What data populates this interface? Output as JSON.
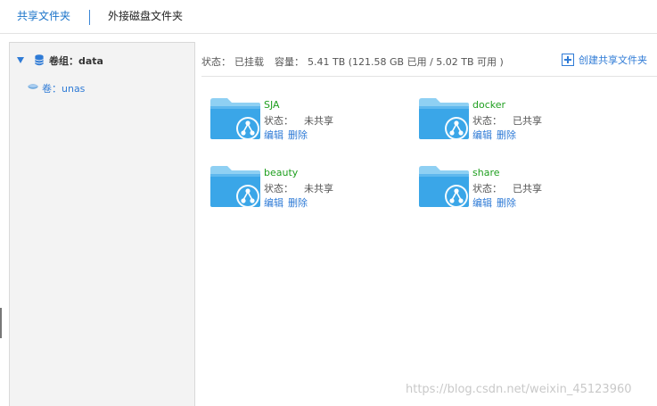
{
  "tabs": [
    {
      "label": "共享文件夹",
      "active": true
    },
    {
      "label": "外接磁盘文件夹",
      "active": false
    }
  ],
  "sidebar": {
    "group_label": "卷组：data",
    "volume_label": "卷：unas"
  },
  "status_bar": {
    "status_key": "状态：",
    "status_value": "已挂载",
    "capacity_key": "容量：",
    "capacity_value": "5.41 TB (121.58 GB 已用 / 5.02 TB 可用 )",
    "create_label": "创建共享文件夹"
  },
  "folders": [
    {
      "name": "SJA",
      "status_key": "状态：",
      "status_value": "未共享",
      "edit": "编辑",
      "delete": "删除"
    },
    {
      "name": "docker",
      "status_key": "状态：",
      "status_value": "已共享",
      "edit": "编辑",
      "delete": "删除"
    },
    {
      "name": "beauty",
      "status_key": "状态：",
      "status_value": "未共享",
      "edit": "编辑",
      "delete": "删除"
    },
    {
      "name": "share",
      "status_key": "状态：",
      "status_value": "已共享",
      "edit": "编辑",
      "delete": "删除"
    }
  ],
  "watermark": "https://blog.csdn.net/weixin_45123960",
  "colors": {
    "accent": "#2f7bd6",
    "folder_name": "#1f9f1f",
    "folder_body": "#3aa6e8",
    "folder_tab": "#8fd0f3"
  },
  "icons": {
    "tree_toggle": "triangle-down-icon",
    "volume_group": "database-icon",
    "volume": "disk-icon",
    "create": "plus-square-icon",
    "folder": "shared-folder-icon"
  }
}
